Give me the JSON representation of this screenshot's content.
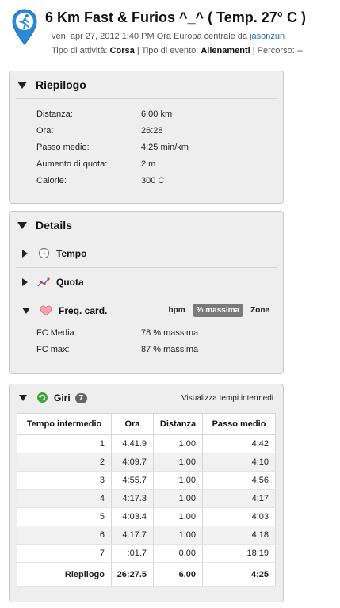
{
  "header": {
    "title": "6 Km Fast & Furios ^_^ ( Temp. 27° C )",
    "datetime": "ven, apr 27, 2012 1:40 PM Ora Europa centrale da ",
    "user": "jasonzun",
    "activity_type_label": "Tipo di attività: ",
    "activity_type": "Corsa",
    "sep1": " | Tipo di evento: ",
    "event_type": "Allenamenti",
    "sep2": " | Percorso: --"
  },
  "summary": {
    "title": "Riepilogo",
    "rows": [
      {
        "label": "Distanza:",
        "value": "6.00 km"
      },
      {
        "label": "Ora:",
        "value": "26:28"
      },
      {
        "label": "Passo medio:",
        "value": "4:25 min/km"
      },
      {
        "label": "Aumento di quota:",
        "value": "2 m"
      },
      {
        "label": "Calorie:",
        "value": "300 C"
      }
    ]
  },
  "details": {
    "title": "Details",
    "tempo": "Tempo",
    "quota": "Quota",
    "hr": "Freq. card.",
    "units": {
      "bpm": "bpm",
      "max": "% massima",
      "zone": "Zone"
    },
    "hr_rows": [
      {
        "label": "FC Media:",
        "value": "78 % massima"
      },
      {
        "label": "FC max:",
        "value": "87 % massima"
      }
    ]
  },
  "laps": {
    "title": "Giri",
    "count": "7",
    "link": "Visualizza tempi intermedi",
    "columns": [
      "Tempo intermedio",
      "Ora",
      "Distanza",
      "Passo medio"
    ],
    "rows": [
      [
        "1",
        "4:41.9",
        "1.00",
        "4:42"
      ],
      [
        "2",
        "4:09.7",
        "1.00",
        "4:10"
      ],
      [
        "3",
        "4:55.7",
        "1.00",
        "4:56"
      ],
      [
        "4",
        "4:17.3",
        "1.00",
        "4:17"
      ],
      [
        "5",
        "4:03.4",
        "1.00",
        "4:03"
      ],
      [
        "6",
        "4:17.7",
        "1.00",
        "4:18"
      ],
      [
        "7",
        ":01.7",
        "0.00",
        "18:19"
      ]
    ],
    "total": [
      "Riepilogo",
      "26:27.5",
      "6.00",
      "4:25"
    ]
  },
  "colors": {
    "accent_blue": "#2a8ad8",
    "link": "#2a6fb5",
    "badge": "#666666"
  },
  "icons": [
    "running-pin-icon",
    "clock-icon",
    "elevation-chart-icon",
    "heart-icon",
    "refresh-icon"
  ]
}
